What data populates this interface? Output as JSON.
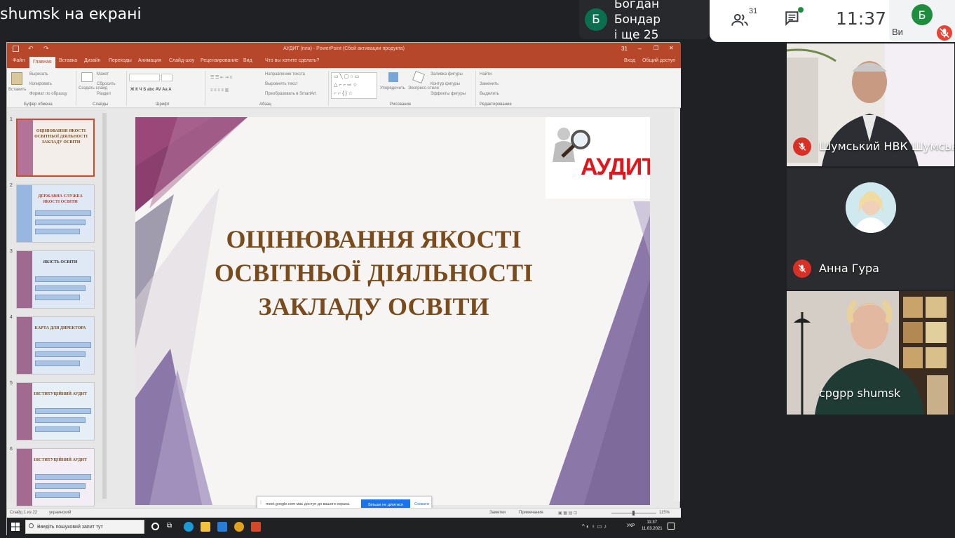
{
  "meet": {
    "presentation_label": "shumsk на екрані",
    "presenter": {
      "initial": "Б",
      "line1": "Богдан Бондар",
      "line2": "і ще 25"
    },
    "participants_count": "31",
    "time": "11:37",
    "self": {
      "initial": "Б",
      "label": "Ви"
    },
    "tiles": [
      {
        "name": "Шумський НВК Шумськ..."
      },
      {
        "name": "Анна Гура"
      },
      {
        "name": "срgрр shumsk"
      }
    ],
    "colors": {
      "accent_green": "#1e8e3e",
      "mic_off": "#d93025"
    }
  },
  "ppt": {
    "window_title": "АУДИТ (пла) - PowerPoint (Сбой активации продукта)",
    "title_controls": [
      "31",
      "–",
      "❐",
      "✕"
    ],
    "tabs": [
      "Файл",
      "Главная",
      "Вставка",
      "Дизайн",
      "Переходы",
      "Анимация",
      "Слайд-шоу",
      "Рецензирование",
      "Вид",
      "Что вы хотите сделать?"
    ],
    "tabs_right": [
      "Вход",
      "Общий доступ"
    ],
    "ribbon": {
      "paste": "Вставить",
      "clipboard": [
        "Вырезать",
        "Копировать",
        "Формат по образцу"
      ],
      "slides": [
        "Создать слайд",
        "Макет",
        "Сбросить",
        "Раздел"
      ],
      "drawing_tools": [
        "Упорядочить",
        "Экспресс-стили",
        "Заливка фигуры",
        "Контур фигуры",
        "Эффекты фигуры"
      ],
      "paragraph_tools": [
        "Направление текста",
        "Выровнять текст",
        "Преобразовать в SmartArt"
      ],
      "editing": [
        "Найти",
        "Заменить",
        "Выделить"
      ],
      "groups": [
        "Буфер обмена",
        "Слайды",
        "Шрифт",
        "Абзац",
        "Рисование",
        "Редактирование"
      ]
    },
    "thumbnails": [
      {
        "num": "1",
        "title": "ОЦІНЮВАННЯ ЯКОСТІ ОСВІТНЬОЇ ДІЯЛЬНОСТІ ЗАКЛАДУ ОСВІТИ"
      },
      {
        "num": "2",
        "title": "ДЕРЖАВНА СЛУЖБА ЯКОСТІ ОСВІТИ"
      },
      {
        "num": "3",
        "title": "ЯКІСТЬ ОСВІТИ"
      },
      {
        "num": "4",
        "title": "КАРТА ДЛЯ ДИРЕКТОРА"
      },
      {
        "num": "5",
        "title": "ІНСТИТУЦІЙНИЙ АУДИТ"
      },
      {
        "num": "6",
        "title": "ІНСТИТУЦІЙНИЙ АУДИТ"
      }
    ],
    "slide": {
      "title_lines": [
        "ОЦІНЮВАННЯ ЯКОСТІ",
        "ОСВІТНЬОЇ ДІЯЛЬНОСТІ",
        "ЗАКЛАДУ ОСВІТИ"
      ],
      "logo_text": "АУДИТ"
    },
    "notification": {
      "text": "meet.google.com має доступ до вашого екрана.",
      "stop": "Більше не ділитися",
      "hide": "Сховати"
    },
    "status": {
      "slide_info": "Слайд 1 из 22",
      "language": "украинский",
      "notes": "Заметки",
      "comments": "Примечания",
      "zoom": "115%"
    },
    "taskbar": {
      "search_placeholder": "Введіть пошуковий запит тут",
      "time": "11:37",
      "date": "11.03.2021",
      "lang": "УКР"
    },
    "colors": {
      "ppt_accent": "#b7472a",
      "slide_title": "#7a4b1c",
      "logo_red": "#e0161a"
    }
  }
}
